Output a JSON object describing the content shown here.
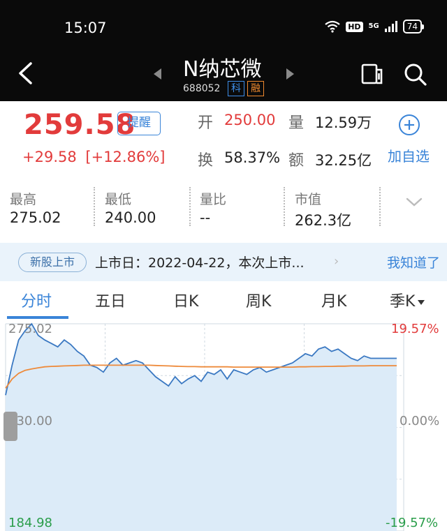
{
  "status_bar": {
    "time": "15:07",
    "hd": "HD",
    "network": "5G",
    "battery": "74",
    "icons": [
      "wifi-icon",
      "signal-icon",
      "battery-icon"
    ]
  },
  "header": {
    "stock_name": "N纳芯微",
    "stock_code": "688052",
    "tag_ke": "科",
    "tag_rong": "融"
  },
  "quote": {
    "price": "259.58",
    "remind_label": "提醒",
    "change": "+29.58",
    "change_pct": "[+12.86%]",
    "open_label": "开",
    "open_value": "250.00",
    "volume_label": "量",
    "volume_value": "12.59万",
    "turnover_label": "换",
    "turnover_value": "58.37%",
    "amount_label": "额",
    "amount_value": "32.25亿",
    "add_watch_label": "加自选"
  },
  "stats": [
    {
      "label": "最高",
      "value": "275.02"
    },
    {
      "label": "最低",
      "value": "240.00"
    },
    {
      "label": "量比",
      "value": "--"
    },
    {
      "label": "市值",
      "value": "262.3亿"
    }
  ],
  "notice": {
    "badge": "新股上市",
    "text": "上市日：2022-04-22，本次上市...",
    "chevron": "›",
    "ack": "我知道了"
  },
  "tabs": [
    {
      "label": "分时",
      "active": true
    },
    {
      "label": "五日",
      "active": false
    },
    {
      "label": "日K",
      "active": false
    },
    {
      "label": "周K",
      "active": false
    },
    {
      "label": "月K",
      "active": false
    },
    {
      "label": "季K",
      "active": false
    }
  ],
  "colors": {
    "up": "#e23b3b",
    "down": "#2a9d4a",
    "accent": "#3a84d8",
    "price_line": "#3a78c2",
    "avg_line": "#ee8a3a"
  },
  "chart_data": {
    "type": "line",
    "title": "",
    "xlabel": "",
    "ylabel": "",
    "y_ticks": [
      "275.02",
      "230.00",
      "184.98"
    ],
    "y_right_ticks": [
      "19.57%",
      "0.00%",
      "-19.57%"
    ],
    "ylim": [
      184.98,
      275.02
    ],
    "x": [
      0,
      4,
      8,
      12,
      16,
      20,
      24,
      28,
      32,
      36,
      40,
      44,
      48,
      52,
      56,
      60,
      64,
      68,
      72,
      76,
      80,
      84,
      88,
      92,
      96,
      100,
      104,
      108,
      112,
      116,
      120,
      124,
      128,
      132,
      136,
      140,
      144,
      148,
      152,
      156,
      160,
      164,
      168,
      172,
      176,
      180,
      184,
      188,
      192,
      196,
      200,
      204,
      208,
      212,
      216,
      220,
      224,
      228,
      232,
      236,
      240
    ],
    "series": [
      {
        "values": [
          244.0,
          257.0,
          268.0,
          272.0,
          275.0,
          270.0,
          268.0,
          266.5,
          265.0,
          268.0,
          266.0,
          263.0,
          261.0,
          257.0,
          256.0,
          254.0,
          258.0,
          260.0,
          257.0,
          258.0,
          259.0,
          258.0,
          255.0,
          252.0,
          250.0,
          248.0,
          252.0,
          249.0,
          251.0,
          252.5,
          250.0,
          254.0,
          253.0,
          255.0,
          251.0,
          255.0,
          254.0,
          253.0,
          255.0,
          256.0,
          254.0,
          255.0,
          256.0,
          257.0,
          258.0,
          260.0,
          262.0,
          261.0,
          264.0,
          265.0,
          263.0,
          264.0,
          262.0,
          260.0,
          259.0,
          261.0,
          260.0,
          260.0,
          260.0,
          260.0,
          260.0
        ]
      },
      {
        "values": [
          247.0,
          251.0,
          253.5,
          254.8,
          255.4,
          255.9,
          256.3,
          256.5,
          256.6,
          256.7,
          256.8,
          256.9,
          257.0,
          257.0,
          257.0,
          257.0,
          257.0,
          257.0,
          257.0,
          257.0,
          257.0,
          257.0,
          257.0,
          256.9,
          256.8,
          256.7,
          256.6,
          256.5,
          256.4,
          256.4,
          256.3,
          256.3,
          256.3,
          256.3,
          256.3,
          256.2,
          256.2,
          256.2,
          256.2,
          256.2,
          256.2,
          256.2,
          256.2,
          256.2,
          256.2,
          256.3,
          256.3,
          256.4,
          256.4,
          256.5,
          256.5,
          256.6,
          256.6,
          256.7,
          256.7,
          256.7,
          256.8,
          256.8,
          256.8,
          256.8,
          256.8
        ]
      }
    ]
  }
}
